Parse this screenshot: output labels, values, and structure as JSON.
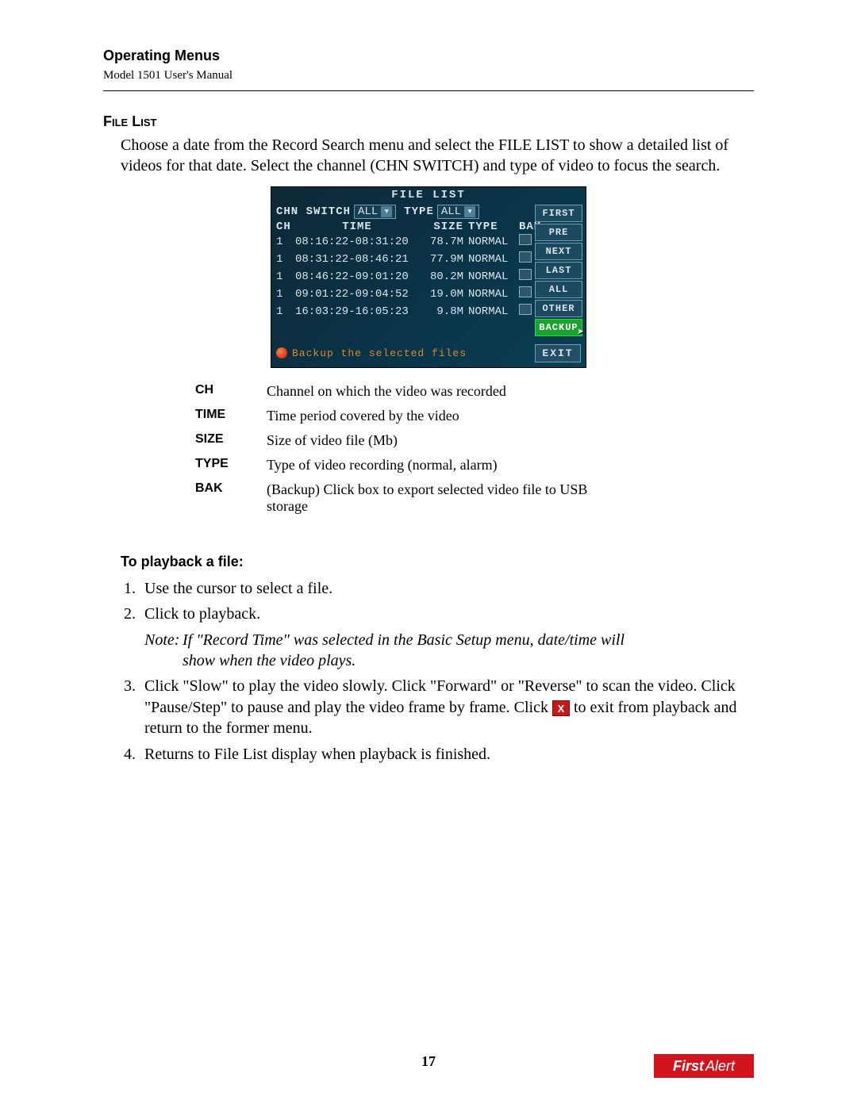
{
  "header": {
    "chapter": "Operating Menus",
    "manual_line": "Model 1501 User's Manual"
  },
  "section": {
    "title": "File List",
    "intro": "Choose a date from the Record Search menu and select the FILE LIST to show a detailed list of videos for that date. Select the channel (CHN SWITCH) and type of video to focus the search."
  },
  "screenshot": {
    "title": "FILE LIST",
    "chn_switch_label": "CHN SWITCH",
    "chn_switch_value": "ALL",
    "type_label": "TYPE",
    "type_value": "ALL",
    "columns": {
      "ch": "CH",
      "time": "TIME",
      "size": "SIZE",
      "type": "TYPE",
      "bak": "BAK"
    },
    "rows": [
      {
        "ch": "1",
        "time": "08:16:22-08:31:20",
        "size": "78.7M",
        "type": "NORMAL"
      },
      {
        "ch": "1",
        "time": "08:31:22-08:46:21",
        "size": "77.9M",
        "type": "NORMAL"
      },
      {
        "ch": "1",
        "time": "08:46:22-09:01:20",
        "size": "80.2M",
        "type": "NORMAL"
      },
      {
        "ch": "1",
        "time": "09:01:22-09:04:52",
        "size": "19.0M",
        "type": "NORMAL"
      },
      {
        "ch": "1",
        "time": "16:03:29-16:05:23",
        "size": "9.8M",
        "type": "NORMAL"
      }
    ],
    "side_buttons": [
      "FIRST",
      "PRE",
      "NEXT",
      "LAST",
      "ALL",
      "OTHER",
      "BACKUP"
    ],
    "footer_msg": "Backup the selected files",
    "exit_label": "EXIT"
  },
  "definitions": [
    {
      "term": "CH",
      "desc": "Channel on which the video was recorded"
    },
    {
      "term": "TIME",
      "desc": "Time period covered by the video"
    },
    {
      "term": "SIZE",
      "desc": "Size of video file (Mb)"
    },
    {
      "term": "TYPE",
      "desc": "Type of video recording (normal, alarm)"
    },
    {
      "term": "BAK",
      "desc": "(Backup) Click box to export selected video file to USB storage"
    }
  ],
  "playback": {
    "heading": "To playback a file:",
    "step1": "Use the cursor to select a file.",
    "step2": "Click to playback.",
    "note_label": "Note:",
    "note_line1": "If \"Record Time\" was selected in the Basic Setup menu, date/time will",
    "note_line2": "show when the video plays.",
    "step3_a": "Click \"Slow\" to play the video slowly. Click \"Forward\" or \"Reverse\" to scan the video. Click \"Pause/Step\" to pause and play the video frame by frame. Click ",
    "step3_badge": "X",
    "step3_b": " to exit from playback and return to the former menu.",
    "step4": "Returns to File List display when playback is finished."
  },
  "page_number": "17",
  "logo": {
    "first": "First",
    "alert": "Alert"
  }
}
